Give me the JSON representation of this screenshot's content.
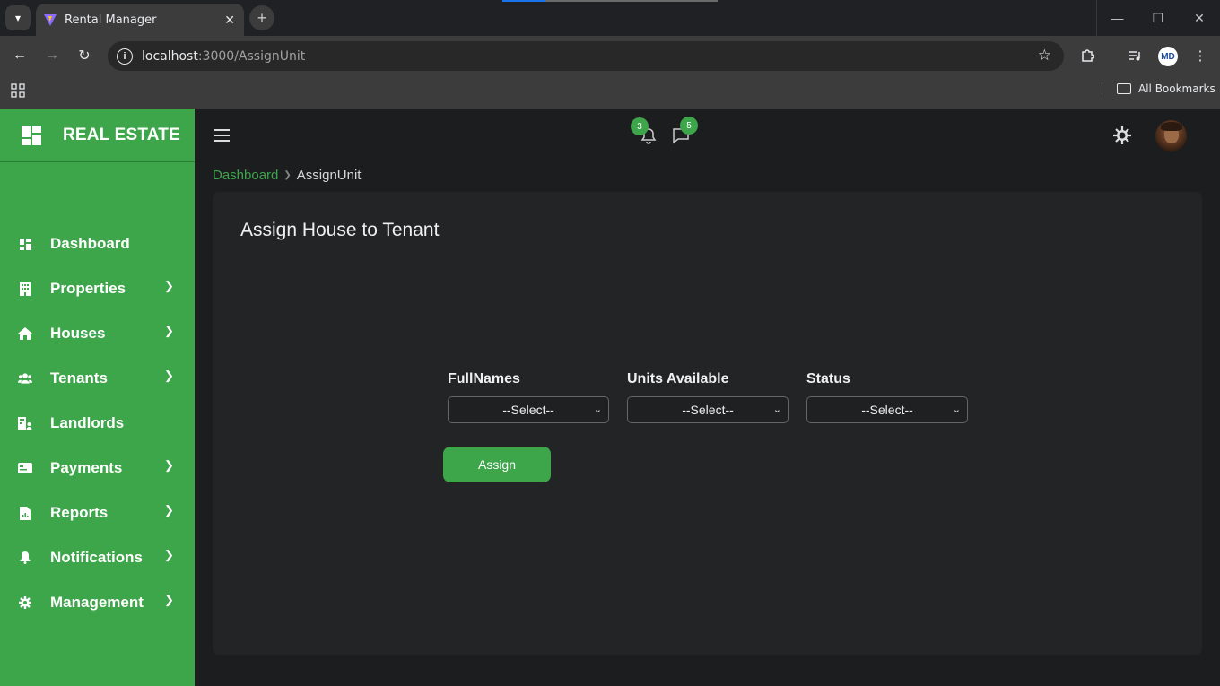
{
  "browser": {
    "tab_title": "Rental Manager",
    "url_host": "localhost",
    "url_path": ":3000/AssignUnit",
    "bookmarks_label": "All Bookmarks",
    "profile_initials": "MD"
  },
  "sidebar": {
    "brand": "REAL ESTATE",
    "accent_color": "#3da54a",
    "items": [
      {
        "label": "Dashboard",
        "icon": "dashboard-icon",
        "has_submenu": false
      },
      {
        "label": "Properties",
        "icon": "building-icon",
        "has_submenu": true
      },
      {
        "label": "Houses",
        "icon": "home-icon",
        "has_submenu": true
      },
      {
        "label": "Tenants",
        "icon": "users-icon",
        "has_submenu": true
      },
      {
        "label": "Landlords",
        "icon": "landlord-icon",
        "has_submenu": false
      },
      {
        "label": "Payments",
        "icon": "payment-card-icon",
        "has_submenu": true
      },
      {
        "label": "Reports",
        "icon": "report-icon",
        "has_submenu": true
      },
      {
        "label": "Notifications",
        "icon": "bell-icon",
        "has_submenu": true
      },
      {
        "label": "Management",
        "icon": "gear-icon",
        "has_submenu": true
      }
    ]
  },
  "header": {
    "notification_count": "3",
    "message_count": "5"
  },
  "breadcrumb": {
    "home": "Dashboard",
    "current": "AssignUnit"
  },
  "form": {
    "title": "Assign House to Tenant",
    "fields": [
      {
        "label": "FullNames",
        "value": "--Select--"
      },
      {
        "label": "Units Available",
        "value": "--Select--"
      },
      {
        "label": "Status",
        "value": "--Select--"
      }
    ],
    "submit_label": "Assign"
  }
}
